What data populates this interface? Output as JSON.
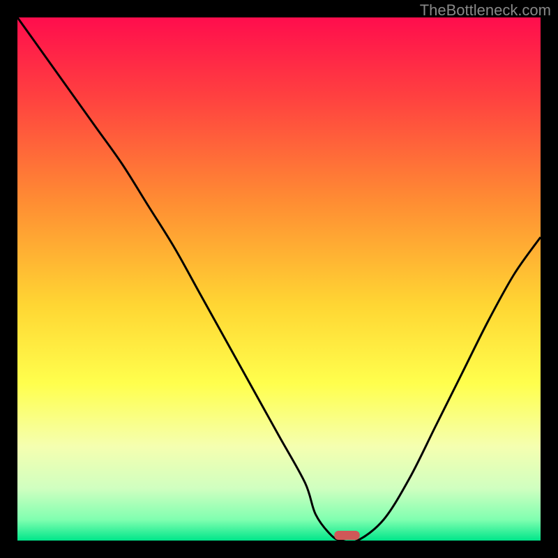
{
  "watermark": "TheBottleneck.com",
  "chart_data": {
    "type": "line",
    "title": "",
    "xlabel": "",
    "ylabel": "",
    "xlim": [
      0,
      100
    ],
    "ylim": [
      0,
      100
    ],
    "x": [
      0,
      5,
      10,
      15,
      20,
      25,
      30,
      35,
      40,
      45,
      50,
      55,
      57,
      60,
      62,
      65,
      70,
      75,
      80,
      85,
      90,
      95,
      100
    ],
    "values": [
      100,
      93,
      86,
      79,
      72,
      64,
      56,
      47,
      38,
      29,
      20,
      11,
      5,
      1,
      0,
      0,
      4,
      12,
      22,
      32,
      42,
      51,
      58
    ],
    "optimal_x": 63,
    "optimal_width": 3,
    "background": {
      "type": "gradient",
      "stops": [
        {
          "pos": 0.0,
          "color": "#ff0d4d"
        },
        {
          "pos": 0.15,
          "color": "#ff4040"
        },
        {
          "pos": 0.35,
          "color": "#ff8c33"
        },
        {
          "pos": 0.55,
          "color": "#ffd633"
        },
        {
          "pos": 0.7,
          "color": "#ffff4d"
        },
        {
          "pos": 0.82,
          "color": "#f5ffb0"
        },
        {
          "pos": 0.9,
          "color": "#d0ffc0"
        },
        {
          "pos": 0.96,
          "color": "#80ffb0"
        },
        {
          "pos": 1.0,
          "color": "#00e68a"
        }
      ]
    },
    "marker": {
      "color": "#d05858",
      "shape": "rounded-rect"
    }
  }
}
